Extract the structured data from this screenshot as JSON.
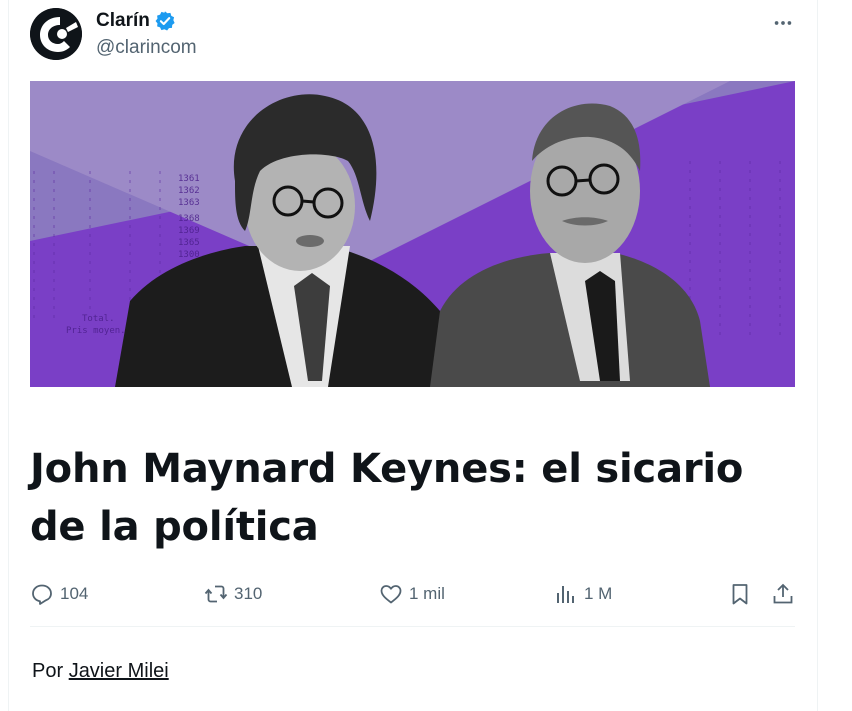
{
  "post": {
    "author_name": "Clarín",
    "author_handle": "@clarincom",
    "headline": "John Maynard Keynes: el sicario de la política",
    "byline_prefix": "Por",
    "byline_author": "Javier Milei"
  },
  "media": {
    "table_lines": [
      "1361",
      "1362",
      "1363",
      "1368",
      "1369",
      "1365",
      "1300",
      "Total.",
      "Pris moyen."
    ],
    "colors": {
      "background": "#7a3fc6",
      "band": "#9c8ac7",
      "text": "#4a1f8a"
    }
  },
  "actions": {
    "reply_count": "104",
    "repost_count": "310",
    "like_count": "1 mil",
    "views_count": "1 M"
  },
  "icons": {
    "avatar": "clarin-logo-icon",
    "verified": "verified-badge-icon",
    "more": "more-dots-icon",
    "reply": "reply-bubble-icon",
    "repost": "repost-arrows-icon",
    "like": "heart-icon",
    "views": "bar-chart-icon",
    "bookmark": "bookmark-icon",
    "share": "share-upload-icon"
  },
  "colors": {
    "text_primary": "#0f1419",
    "text_secondary": "#536471",
    "verified_blue": "#1d9bf0",
    "border": "#eff3f4"
  }
}
